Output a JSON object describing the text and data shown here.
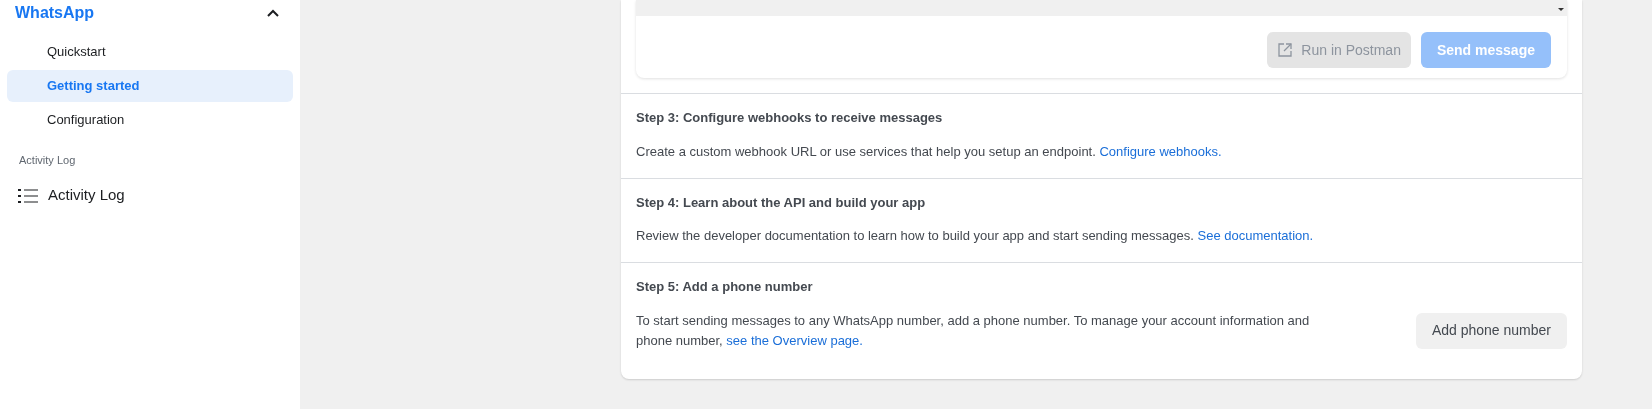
{
  "sidebar": {
    "section": {
      "title": "WhatsApp",
      "expanded": true,
      "items": [
        {
          "label": "Quickstart",
          "selected": false
        },
        {
          "label": "Getting started",
          "selected": true
        },
        {
          "label": "Configuration",
          "selected": false
        }
      ]
    },
    "group_label": "Activity Log",
    "activity_item": {
      "label": "Activity Log"
    }
  },
  "message_card": {
    "buttons": [
      {
        "kind": "postman",
        "label": "Run in Postman",
        "disabled": true
      },
      {
        "kind": "primary",
        "label": "Send message",
        "disabled": true
      }
    ]
  },
  "steps": [
    {
      "title": "Step 3: Configure webhooks to receive messages",
      "text": "Create a custom webhook URL or use services that help you setup an endpoint.",
      "link": "Configure webhooks."
    },
    {
      "title": "Step 4: Learn about the API and build your app",
      "text": "Review the developer documentation to learn how to build your app and start sending messages.",
      "link": "See documentation."
    },
    {
      "title": "Step 5: Add a phone number",
      "text": "To start sending messages to any WhatsApp number, add a phone number. To manage your account information and phone number,",
      "link": "see the Overview page.",
      "button": "Add phone number"
    }
  ]
}
